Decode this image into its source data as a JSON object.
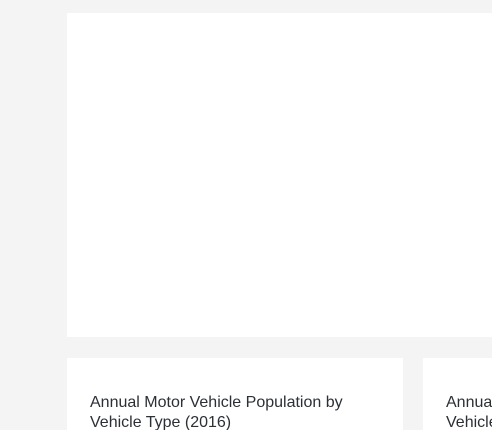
{
  "cards": [
    {
      "title": "Annual Motor Vehicle Population by Vehicle Type (2016)"
    },
    {
      "title": "Annual Motor Vehicle Population by Vehicle Type"
    }
  ]
}
